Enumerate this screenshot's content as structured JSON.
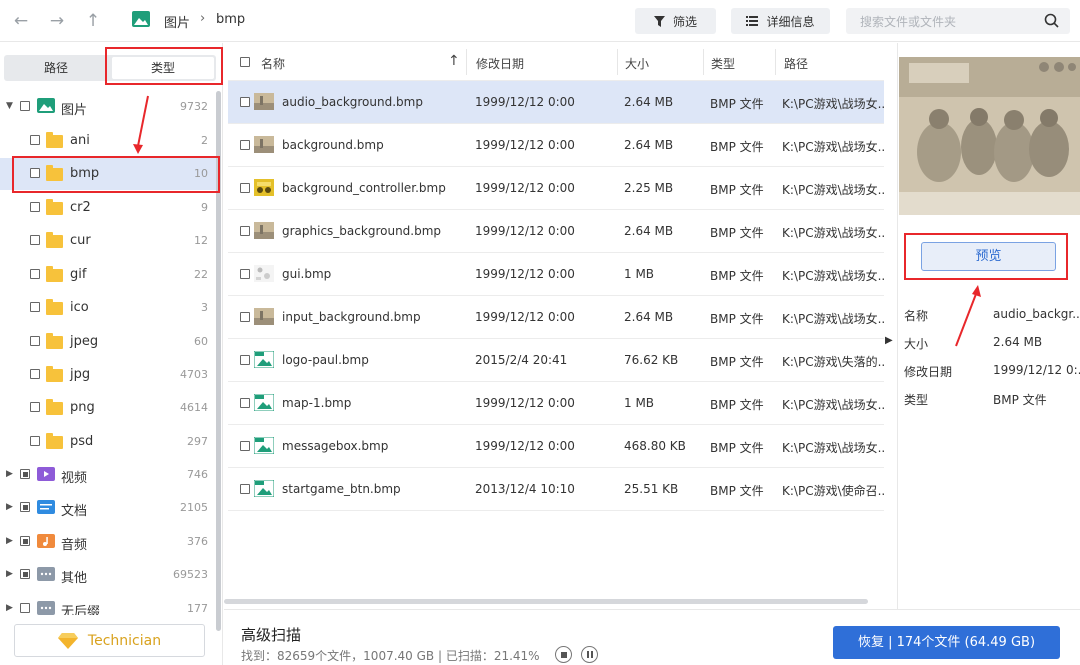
{
  "toolbar": {
    "breadcrumb_root": "图片",
    "breadcrumb_sep": "›",
    "breadcrumb_current": "bmp",
    "filter_label": "筛选",
    "details_label": "详细信息",
    "search_placeholder": "搜索文件或文件夹"
  },
  "left": {
    "tab_path": "路径",
    "tab_type": "类型",
    "tree": [
      {
        "label": "图片",
        "count": "9732"
      },
      {
        "label": "ani",
        "count": "2"
      },
      {
        "label": "bmp",
        "count": "10"
      },
      {
        "label": "cr2",
        "count": "9"
      },
      {
        "label": "cur",
        "count": "12"
      },
      {
        "label": "gif",
        "count": "22"
      },
      {
        "label": "ico",
        "count": "3"
      },
      {
        "label": "jpeg",
        "count": "60"
      },
      {
        "label": "jpg",
        "count": "4703"
      },
      {
        "label": "png",
        "count": "4614"
      },
      {
        "label": "psd",
        "count": "297"
      },
      {
        "label": "视频",
        "count": "746"
      },
      {
        "label": "文档",
        "count": "2105"
      },
      {
        "label": "音频",
        "count": "376"
      },
      {
        "label": "其他",
        "count": "69523"
      },
      {
        "label": "无后缀",
        "count": "177"
      }
    ],
    "technician_label": "Technician"
  },
  "table": {
    "headers": {
      "name": "名称",
      "date": "修改日期",
      "size": "大小",
      "type": "类型",
      "path": "路径"
    },
    "rows": [
      {
        "name": "audio_background.bmp",
        "date": "1999/12/12 0:00",
        "size": "2.64 MB",
        "type": "BMP 文件",
        "path": "K:\\PC游戏\\战场女.."
      },
      {
        "name": "background.bmp",
        "date": "1999/12/12 0:00",
        "size": "2.64 MB",
        "type": "BMP 文件",
        "path": "K:\\PC游戏\\战场女.."
      },
      {
        "name": "background_controller.bmp",
        "date": "1999/12/12 0:00",
        "size": "2.25 MB",
        "type": "BMP 文件",
        "path": "K:\\PC游戏\\战场女.."
      },
      {
        "name": "graphics_background.bmp",
        "date": "1999/12/12 0:00",
        "size": "2.64 MB",
        "type": "BMP 文件",
        "path": "K:\\PC游戏\\战场女.."
      },
      {
        "name": "gui.bmp",
        "date": "1999/12/12 0:00",
        "size": "1 MB",
        "type": "BMP 文件",
        "path": "K:\\PC游戏\\战场女.."
      },
      {
        "name": "input_background.bmp",
        "date": "1999/12/12 0:00",
        "size": "2.64 MB",
        "type": "BMP 文件",
        "path": "K:\\PC游戏\\战场女.."
      },
      {
        "name": "logo-paul.bmp",
        "date": "2015/2/4 20:41",
        "size": "76.62 KB",
        "type": "BMP 文件",
        "path": "K:\\PC游戏\\失落的.."
      },
      {
        "name": "map-1.bmp",
        "date": "1999/12/12 0:00",
        "size": "1 MB",
        "type": "BMP 文件",
        "path": "K:\\PC游戏\\战场女.."
      },
      {
        "name": "messagebox.bmp",
        "date": "1999/12/12 0:00",
        "size": "468.80 KB",
        "type": "BMP 文件",
        "path": "K:\\PC游戏\\战场女.."
      },
      {
        "name": "startgame_btn.bmp",
        "date": "2013/12/4 10:10",
        "size": "25.51 KB",
        "type": "BMP 文件",
        "path": "K:\\PC游戏\\使命召.."
      }
    ]
  },
  "right": {
    "preview_label": "预览",
    "meta": [
      {
        "key": "名称",
        "value": "audio_backgr..."
      },
      {
        "key": "大小",
        "value": "2.64 MB"
      },
      {
        "key": "修改日期",
        "value": "1999/12/12 0:..."
      },
      {
        "key": "类型",
        "value": "BMP 文件"
      }
    ]
  },
  "bottom": {
    "title": "高级扫描",
    "stats": "找到：82659个文件，1007.40 GB | 已扫描：21.41%",
    "recover_label": "恢复 | 174个文件 (64.49 GB)"
  },
  "colors": {
    "accent": "#2f6fd8",
    "selected_row": "#dde6f7",
    "folder": "#f7c23b",
    "annotation": "#e8272b"
  }
}
